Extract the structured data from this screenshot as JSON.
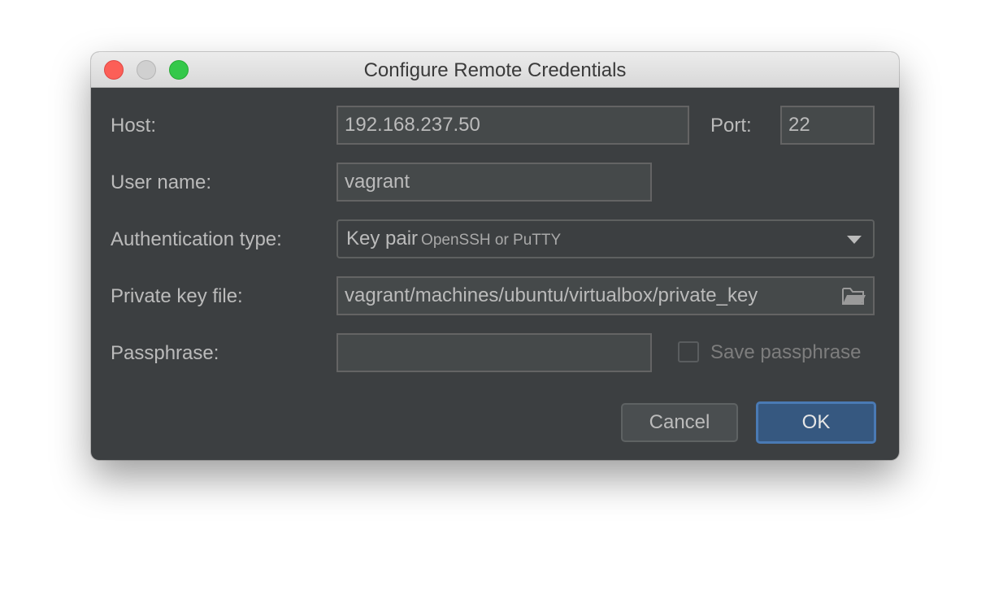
{
  "window": {
    "title": "Configure Remote Credentials"
  },
  "form": {
    "host_label": "Host:",
    "host_value": "192.168.237.50",
    "port_label": "Port:",
    "port_value": "22",
    "username_label": "User name:",
    "username_value": "vagrant",
    "auth_label": "Authentication type:",
    "auth_value": "Key pair",
    "auth_hint": "OpenSSH or PuTTY",
    "keyfile_label": "Private key file:",
    "keyfile_value": "vagrant/machines/ubuntu/virtualbox/private_key",
    "passphrase_label": "Passphrase:",
    "passphrase_value": "",
    "save_passphrase_label": "Save passphrase",
    "save_passphrase_checked": false
  },
  "buttons": {
    "cancel": "Cancel",
    "ok": "OK"
  },
  "icons": {
    "close": "close-icon",
    "minimize": "minimize-icon",
    "maximize": "maximize-icon",
    "dropdown": "chevron-down-icon",
    "browse": "folder-icon"
  },
  "colors": {
    "dialog_background": "#3c3f41",
    "field_background": "#45494a",
    "primary_button": "#365880",
    "text": "#bbbbbb"
  }
}
